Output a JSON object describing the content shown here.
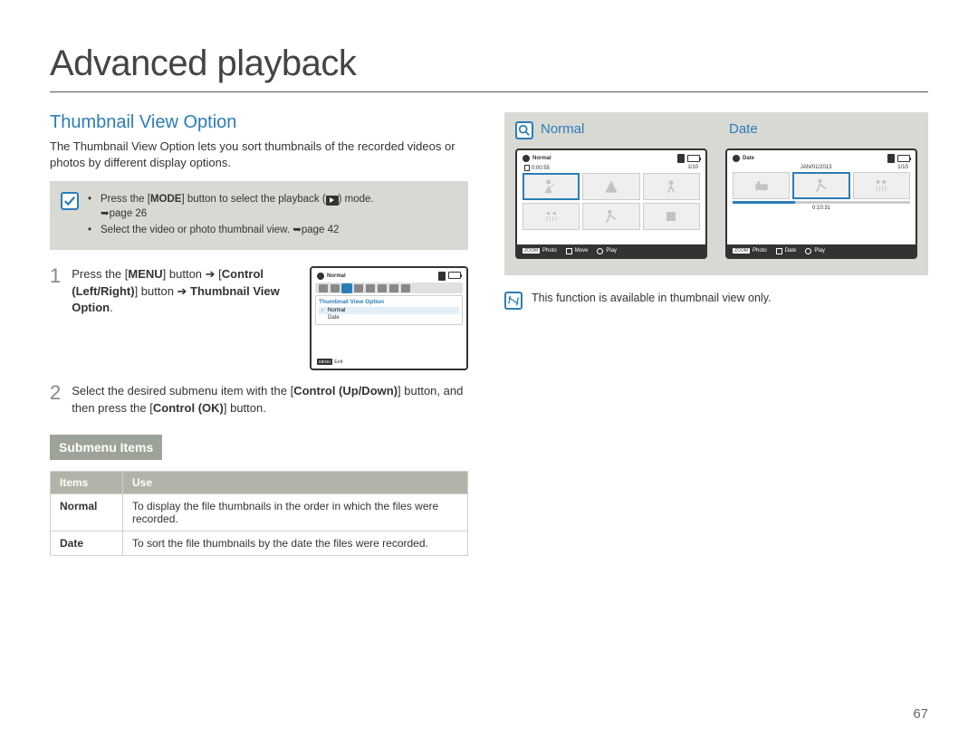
{
  "page_title": "Advanced playback",
  "page_number": "67",
  "left": {
    "section_heading": "Thumbnail View Option",
    "intro": "The Thumbnail View Option lets you sort thumbnails of the recorded videos or photos by different display options.",
    "callout": {
      "line1_pre": "Press the [",
      "line1_bold": "MODE",
      "line1_mid": "] button to select the playback (",
      "line1_post": ") mode.",
      "line1_ref": "➥page 26",
      "line2": "Select the video or photo thumbnail view. ➥page 42"
    },
    "steps": {
      "s1_num": "1",
      "s1_a": "Press the [",
      "s1_b": "MENU",
      "s1_c": "] button ➔ [",
      "s1_d": "Control (Left/Right)",
      "s1_e": "] button ➔ ",
      "s1_f": "Thumbnail View Option",
      "s1_g": ".",
      "s2_num": "2",
      "s2_a": "Select the desired submenu item with the [",
      "s2_b": "Control (Up/Down)",
      "s2_c": "] button, and then press the [",
      "s2_d": "Control (OK)",
      "s2_e": "] button."
    },
    "menu_shot": {
      "top_label": "Normal",
      "panel_title": "Thumbnail View Option",
      "item1": "Normal",
      "item2": "Date",
      "exit_btn": "MENU",
      "exit_label": "Exit"
    },
    "submenu_heading": "Submenu Items",
    "table": {
      "h1": "Items",
      "h2": "Use",
      "r1c1": "Normal",
      "r1c2": "To display the file thumbnails in the order in which the files were recorded.",
      "r2c1": "Date",
      "r2c2": "To sort the file thumbnails by the date the files were recorded."
    }
  },
  "right": {
    "label_normal": "Normal",
    "label_date": "Date",
    "lcd_normal": {
      "top_label": "Normal",
      "time": "0:00:55",
      "count": "1/10",
      "btn_zoom": "ZOOM",
      "btn_zoom_label": "Photo",
      "btn_move": "Move",
      "btn_play": "Play"
    },
    "lcd_date": {
      "top_label": "Date",
      "date": "JAN/01/2013",
      "count": "1/10",
      "timeline_time": "0:10:31",
      "btn_zoom": "ZOOM",
      "btn_zoom_label": "Photo",
      "btn_date": "Date",
      "btn_play": "Play"
    },
    "note": "This function is available in thumbnail view only."
  }
}
